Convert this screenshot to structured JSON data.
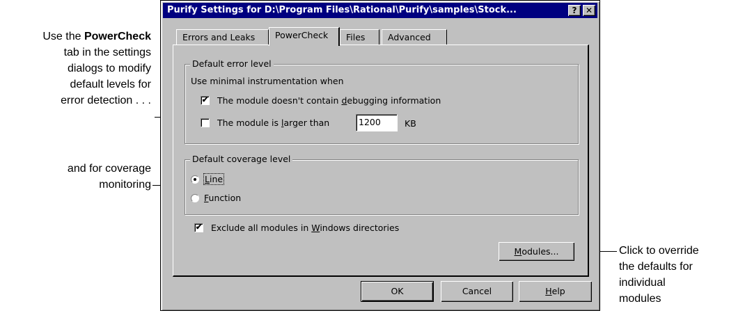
{
  "annotations": {
    "left_top": {
      "line1": "Use the ",
      "bold": "PowerCheck",
      "line2": "tab in the settings",
      "line3": "dialogs to modify",
      "line4": "default levels for",
      "line5": "error detection  .  .  ."
    },
    "left_bottom": {
      "line1": "and for coverage",
      "line2": "monitoring"
    },
    "right": {
      "line1": "Click to override",
      "line2": "the defaults for",
      "line3": "individual",
      "line4": "modules"
    }
  },
  "dialog": {
    "title": "Purify Settings for D:\\Program Files\\Rational\\Purify\\samples\\Stock...",
    "help_btn": "?",
    "close_btn": "✕",
    "tabs": [
      "Errors and Leaks",
      "PowerCheck",
      "Files",
      "Advanced"
    ],
    "error_group": {
      "label": "Default error level",
      "intro": "Use minimal instrumentation when",
      "opt1": {
        "pre": "The module doesn't contain ",
        "accel": "d",
        "post": "ebugging information",
        "checked": true
      },
      "opt2": {
        "pre": "The module is ",
        "accel": "l",
        "post": "arger than",
        "checked": false,
        "value": "1200",
        "unit": "KB"
      }
    },
    "coverage_group": {
      "label": "Default coverage level",
      "line": {
        "accel": "L",
        "rest": "ine",
        "selected": true
      },
      "function": {
        "accel": "F",
        "rest": "unction",
        "selected": false
      }
    },
    "exclude": {
      "pre": "Exclude all modules in ",
      "accel": "W",
      "post": "indows directories",
      "checked": true
    },
    "modules_btn": {
      "accel": "M",
      "rest": "odules..."
    },
    "ok_btn": "OK",
    "cancel_btn": "Cancel",
    "help_button": {
      "accel": "H",
      "rest": "elp"
    }
  }
}
